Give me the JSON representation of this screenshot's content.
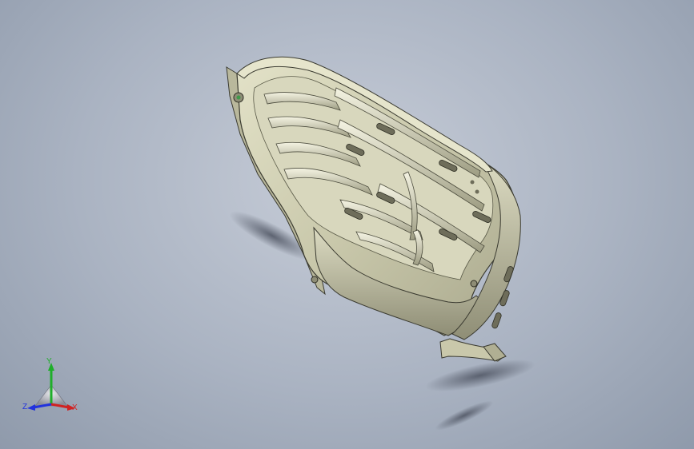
{
  "viewport": {
    "background_colors": [
      "#c7cdd8",
      "#aab3c2",
      "#8f9aab"
    ],
    "model": {
      "part_icon": "sheet-metal-heat-shield",
      "fill_color": "#cdcdb0",
      "edge_color": "#3a3a30",
      "shadow_color": "#5a6170"
    }
  },
  "triad": {
    "x_label": "X",
    "y_label": "Y",
    "z_label": "Z",
    "x_color": "#d02222",
    "y_color": "#1fae2a",
    "z_color": "#2233dd"
  }
}
